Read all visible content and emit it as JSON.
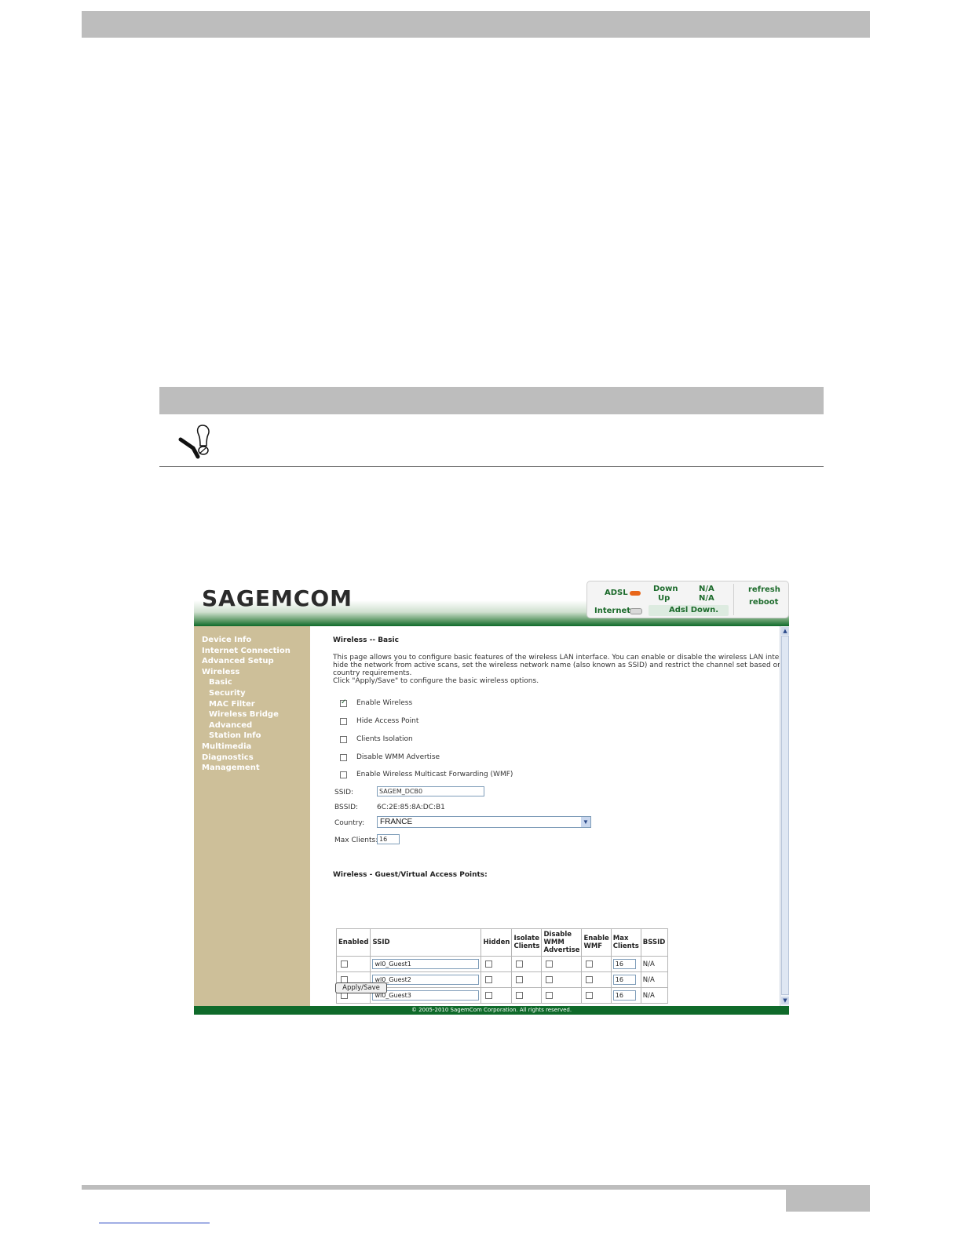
{
  "status": {
    "adsl_label": "ADSL",
    "internet_label": "Internet",
    "down_label": "Down",
    "up_label": "Up",
    "down_value": "N/A",
    "up_value": "N/A",
    "adsl_state": "Adsl Down.",
    "refresh_label": "refresh",
    "reboot_label": "reboot",
    "adsl_led_color": "#e8661a",
    "internet_led_color": "#d9d9d9"
  },
  "brand": {
    "logo_text": "SAGEMCOM"
  },
  "sidebar": {
    "items": [
      {
        "label": "Device Info",
        "level": 0
      },
      {
        "label": "Internet Connection",
        "level": 0
      },
      {
        "label": "Advanced Setup",
        "level": 0
      },
      {
        "label": "Wireless",
        "level": 0
      },
      {
        "label": "Basic",
        "level": 1
      },
      {
        "label": "Security",
        "level": 1
      },
      {
        "label": "MAC Filter",
        "level": 1
      },
      {
        "label": "Wireless Bridge",
        "level": 1
      },
      {
        "label": "Advanced",
        "level": 1
      },
      {
        "label": "Station Info",
        "level": 1
      },
      {
        "label": "Multimedia",
        "level": 0
      },
      {
        "label": "Diagnostics",
        "level": 0
      },
      {
        "label": "Management",
        "level": 0
      }
    ]
  },
  "main": {
    "title": "Wireless -- Basic",
    "desc_lines": [
      "This page allows you to configure basic features of the wireless LAN interface. You can enable or disable the wireless LAN interface,",
      "hide the network from active scans, set the wireless network name (also known as SSID) and restrict the channel set based on",
      "country requirements.",
      "Click \"Apply/Save\" to configure the basic wireless options."
    ],
    "options": [
      {
        "label": "Enable Wireless",
        "checked": true
      },
      {
        "label": "Hide Access Point",
        "checked": false
      },
      {
        "label": "Clients Isolation",
        "checked": false
      },
      {
        "label": "Disable WMM Advertise",
        "checked": false
      },
      {
        "label": "Enable Wireless Multicast Forwarding (WMF)",
        "checked": false
      }
    ],
    "ssid_label": "SSID:",
    "ssid_value": "SAGEM_DCB0",
    "bssid_label": "BSSID:",
    "bssid_value": "6C:2E:85:8A:DC:B1",
    "country_label": "Country:",
    "country_value": "FRANCE",
    "max_clients_label": "Max Clients:",
    "max_clients_value": "16",
    "guest_title": "Wireless - Guest/Virtual Access Points:",
    "guest_headers": [
      "Enabled",
      "SSID",
      "Hidden",
      "Isolate Clients",
      "Disable WMM Advertise",
      "Enable WMF",
      "Max Clients",
      "BSSID"
    ],
    "guest_rows": [
      {
        "ssid": "wl0_Guest1",
        "max": "16",
        "bssid": "N/A"
      },
      {
        "ssid": "wl0_Guest2",
        "max": "16",
        "bssid": "N/A"
      },
      {
        "ssid": "wl0_Guest3",
        "max": "16",
        "bssid": "N/A"
      }
    ],
    "apply_label": "Apply/Save"
  },
  "footer": {
    "copyright": "© 2005-2010 SagemCom Corporation. All rights reserved."
  }
}
